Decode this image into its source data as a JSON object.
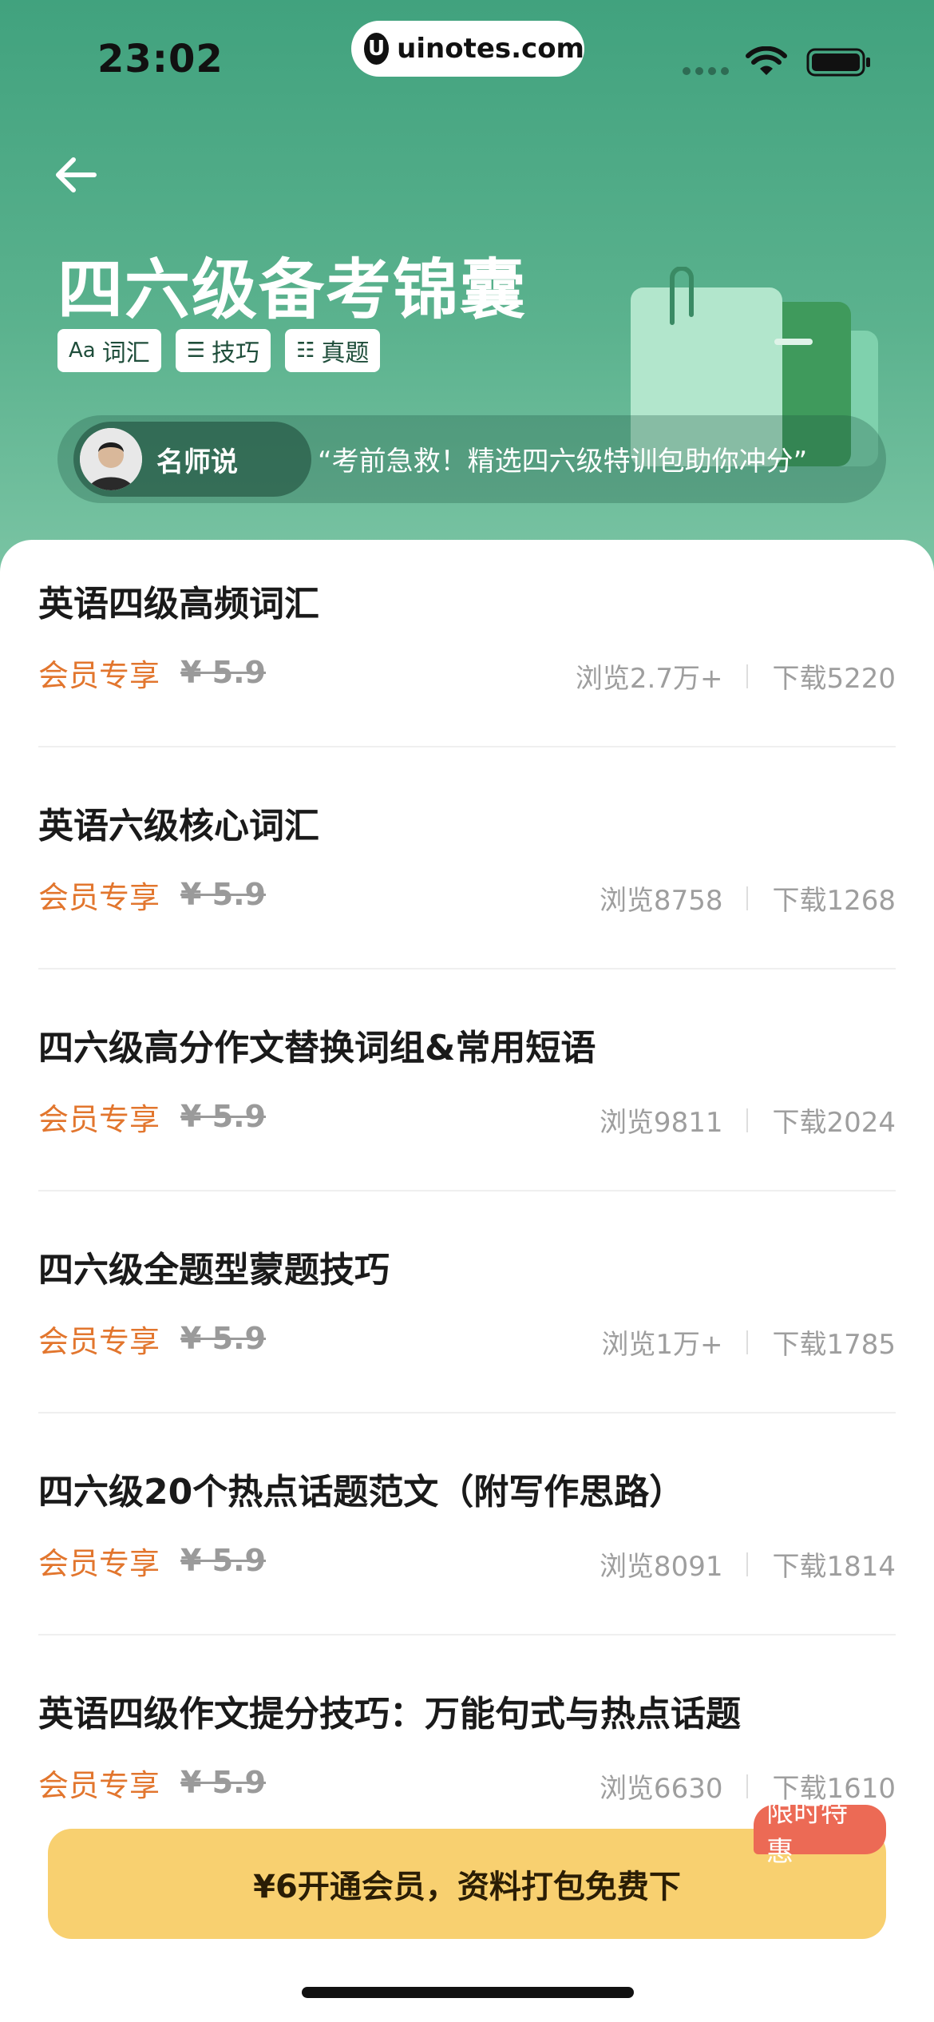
{
  "status_bar": {
    "time": "23:02",
    "url": "uinotes.com",
    "url_logo_glyph": "U"
  },
  "header": {
    "title": "四六级备考锦囊",
    "tags": [
      {
        "icon": "Aa",
        "label": "词汇"
      },
      {
        "icon": "☰",
        "label": "技巧"
      },
      {
        "icon": "☷",
        "label": "真题"
      }
    ],
    "teacher_label": "名师说",
    "quote": "“考前急救！精选四六级特训包助你冲分”"
  },
  "items": [
    {
      "title": "英语四级高频词汇",
      "member": "会员专享",
      "price": "¥ 5.9",
      "views": "浏览2.7万+",
      "downloads": "下载5220"
    },
    {
      "title": "英语六级核心词汇",
      "member": "会员专享",
      "price": "¥ 5.9",
      "views": "浏览8758",
      "downloads": "下载1268"
    },
    {
      "title": "四六级高分作文替换词组&常用短语",
      "member": "会员专享",
      "price": "¥ 5.9",
      "views": "浏览9811",
      "downloads": "下载2024"
    },
    {
      "title": "四六级全题型蒙题技巧",
      "member": "会员专享",
      "price": "¥ 5.9",
      "views": "浏览1万+",
      "downloads": "下载1785"
    },
    {
      "title": "四六级20个热点话题范文（附写作思路）",
      "member": "会员专享",
      "price": "¥ 5.9",
      "views": "浏览8091",
      "downloads": "下载1814"
    },
    {
      "title": "英语四级作文提分技巧：万能句式与热点话题",
      "member": "会员专享",
      "price": "¥ 5.9",
      "views": "浏览6630",
      "downloads": "下载1610"
    }
  ],
  "cta": {
    "label": "¥6开通会员，资料打包免费下",
    "badge": "限时特惠"
  },
  "colors": {
    "hero_top": "#41a27e",
    "accent_orange": "#e2762e",
    "cta_yellow": "#f8d070",
    "badge_red": "#ec6a55"
  }
}
